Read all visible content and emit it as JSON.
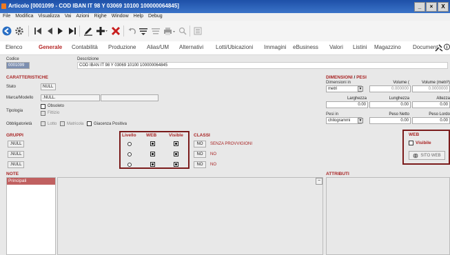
{
  "window": {
    "title": "Articolo [0001099 - COD IBAN IT 98 Y 03069 10100 100000064845]",
    "controls": [
      "_",
      "×",
      "X"
    ]
  },
  "menu": [
    "File",
    "Modifica",
    "Visualizza",
    "Vai",
    "Azioni",
    "Righe",
    "Window",
    "Help",
    "Debug"
  ],
  "tabs": [
    "Elenco",
    "Generale",
    "Contabilità",
    "Produzione",
    "Alias/UM",
    "Alternativi",
    "Lotti/Ubicazioni",
    "Immagini",
    "eBusiness",
    "Valori",
    "Listini",
    "Magazzino",
    "Document"
  ],
  "header": {
    "codice_label": "Codice",
    "codice_value": "0001099",
    "descrizione_label": "Descrizione",
    "descrizione_value": "COD IBAN IT 98 Y 03069 10100 100000064845"
  },
  "caratteristiche": {
    "title": "CARATTERISTICHE",
    "stato_label": "Stato",
    "stato_value": "NULL",
    "marca_label": "Marca/Modello",
    "marca_value": ".NULL.",
    "tipologia_label": "Tipologia",
    "obsoleto": "Obsoleto",
    "fittizio": "Fittizio",
    "obblig_label": "Obbligatorietà",
    "lotto": "Lotto",
    "matricola": "Matricola",
    "giacenza": "Giacenza Positiva"
  },
  "dimensioni": {
    "title1": "DIMENSIONI",
    "sep": " / ",
    "title2": "PESI",
    "dim_in_label": "Dimensioni in",
    "dim_in_value": "metri",
    "volume_label": "Volume (",
    "volume_value": "0.000000",
    "volume_m3_label": "Volume (metri³)",
    "volume_m3_value": "0.0000000",
    "larghezza_label": "Larghezza",
    "larghezza_value": "0.00",
    "lunghezza_label": "Lunghezza",
    "lunghezza_value": "0.00",
    "altezza_label": "Altezza",
    "altezza_value": "0.00",
    "pesi_in_label": "Pesi in",
    "pesi_in_value": "chilogrammi",
    "peso_netto_label": "Peso Netto",
    "peso_netto_value": "0.00",
    "peso_lordo_label": "Peso Lordo",
    "peso_lordo_value": "0.00"
  },
  "gruppi": {
    "title": "GRUPPI",
    "rows": [
      ".NULL",
      ".NULL",
      ".NULL"
    ]
  },
  "flags": {
    "livello": "Livello",
    "web": "WEB",
    "visible": "Visible"
  },
  "classi": {
    "title": "CLASSI",
    "rows": [
      {
        "code": "NO",
        "desc": "SENZA PROVVIGIONI"
      },
      {
        "code": "NO",
        "desc": "NO"
      },
      {
        "code": "NO",
        "desc": "NO"
      }
    ]
  },
  "web": {
    "title": "WEB",
    "visibile": "Visibile",
    "sito_button": "SITO WEB"
  },
  "note": {
    "title": "NOTE",
    "items": [
      "Principali"
    ]
  },
  "attributi": {
    "title": "ATTRIBUTI"
  }
}
